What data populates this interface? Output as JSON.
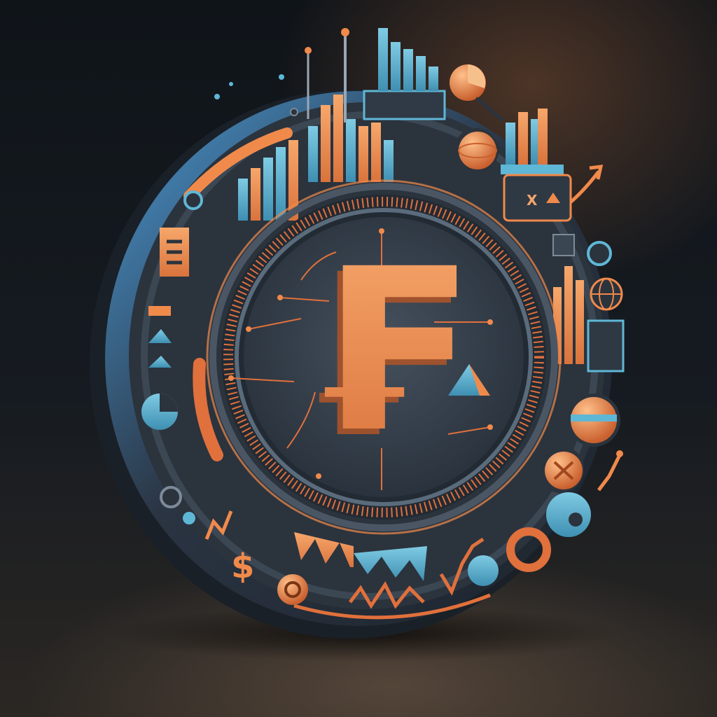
{
  "emblem": {
    "currency_symbol": "₣",
    "dollar_symbol": "$",
    "small_x_label": "X",
    "colors": {
      "accent_orange": "#f08a4b",
      "accent_orange_light": "#f6a66a",
      "accent_blue": "#5fb7d6",
      "ring_dark": "#2b3440",
      "ring_edge_blue": "#3f7fb8",
      "face_dark": "#39434f"
    }
  }
}
